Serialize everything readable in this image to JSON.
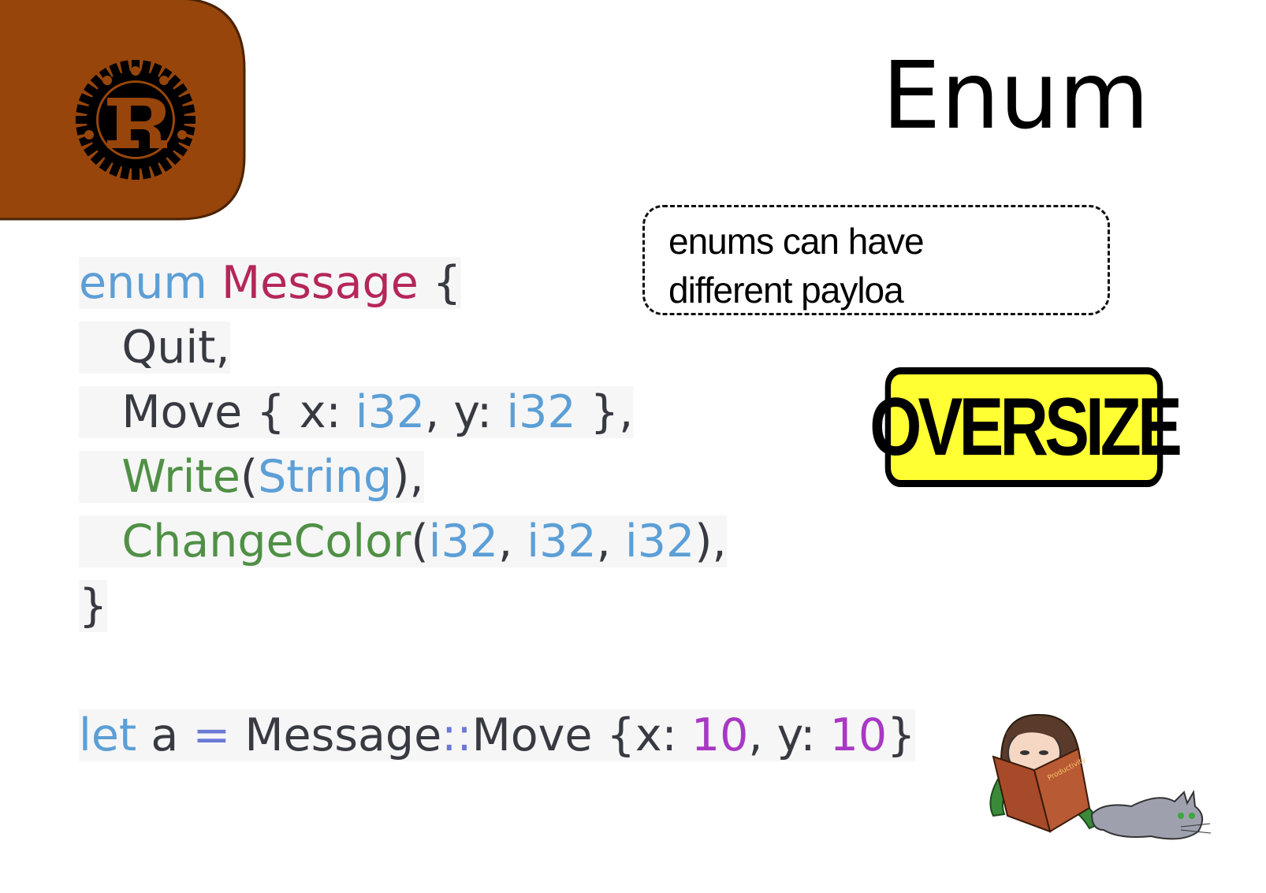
{
  "slide": {
    "title": "Enum",
    "logo_icon": "rust-gear-logo-icon"
  },
  "code": {
    "lines": [
      [
        {
          "t": "enum",
          "c": "kw"
        },
        {
          "t": " "
        },
        {
          "t": "Message",
          "c": "ty"
        },
        {
          "t": " {"
        }
      ],
      [
        {
          "t": "   Quit,"
        }
      ],
      [
        {
          "t": "   Move { x: "
        },
        {
          "t": "i32",
          "c": "kw"
        },
        {
          "t": ", y: "
        },
        {
          "t": "i32",
          "c": "kw"
        },
        {
          "t": " },"
        }
      ],
      [
        {
          "t": "   "
        },
        {
          "t": "Write",
          "c": "fn"
        },
        {
          "t": "("
        },
        {
          "t": "String",
          "c": "kw"
        },
        {
          "t": "),"
        }
      ],
      [
        {
          "t": "   "
        },
        {
          "t": "ChangeColor",
          "c": "fn"
        },
        {
          "t": "("
        },
        {
          "t": "i32",
          "c": "kw"
        },
        {
          "t": ", "
        },
        {
          "t": "i32",
          "c": "kw"
        },
        {
          "t": ", "
        },
        {
          "t": "i32",
          "c": "kw"
        },
        {
          "t": "),"
        }
      ],
      [
        {
          "t": "}"
        }
      ],
      [
        {
          "t": ""
        }
      ],
      [
        {
          "t": "let",
          "c": "kw"
        },
        {
          "t": " a "
        },
        {
          "t": "=",
          "c": "op"
        },
        {
          "t": " Message"
        },
        {
          "t": "::",
          "c": "op"
        },
        {
          "t": "Move {x: "
        },
        {
          "t": "10",
          "c": "num"
        },
        {
          "t": ", y: "
        },
        {
          "t": "10",
          "c": "num"
        },
        {
          "t": "}"
        }
      ]
    ]
  },
  "callout": {
    "line1": "enums can have",
    "line2": "different payloa"
  },
  "badge": {
    "label": "OVERSIZE"
  },
  "illustration": {
    "icon": "person-reading-book-with-cat-icon",
    "book_text": "Productivity"
  },
  "colors": {
    "corner": "#97450a",
    "badge": "#ffff33",
    "keyword": "#5c9fd6",
    "type": "#b5265a",
    "function": "#509046",
    "number": "#a838c4"
  }
}
